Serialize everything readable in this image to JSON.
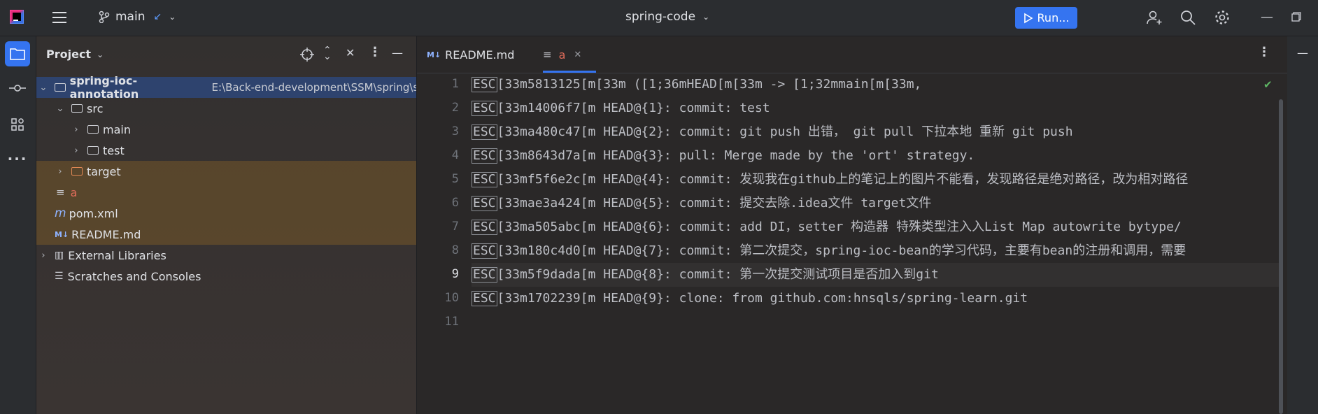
{
  "titlebar": {
    "branch": "main",
    "project": "spring-code",
    "run_label": "Run..."
  },
  "project_panel": {
    "title": "Project",
    "tree": [
      {
        "label": "spring-ioc-annotation",
        "path": "E:\\Back-end-development\\SSM\\spring\\s",
        "kind": "module"
      },
      {
        "label": "src",
        "kind": "folder"
      },
      {
        "label": "main",
        "kind": "folder"
      },
      {
        "label": "test",
        "kind": "folder"
      },
      {
        "label": "target",
        "kind": "folder"
      },
      {
        "label": "a",
        "kind": "file"
      },
      {
        "label": "pom.xml",
        "kind": "file"
      },
      {
        "label": "README.md",
        "kind": "file"
      },
      {
        "label": "External Libraries",
        "kind": "lib"
      },
      {
        "label": "Scratches and Consoles",
        "kind": "scratch"
      }
    ]
  },
  "editor": {
    "tabs": [
      {
        "label": "README.md"
      },
      {
        "label": "a"
      }
    ],
    "line_numbers": [
      "1",
      "2",
      "3",
      "4",
      "5",
      "6",
      "7",
      "8",
      "9",
      "10",
      "11"
    ],
    "lines": [
      "[33m5813125[m[33m ([1;36mHEAD[m[33m -> [1;32mmain[m[33m,",
      "[33m14006f7[m HEAD@{1}: commit: test",
      "[33ma480c47[m HEAD@{2}: commit: git push 出错， git pull 下拉本地 重新 git push",
      "[33m8643d7a[m HEAD@{3}: pull: Merge made by the 'ort' strategy.",
      "[33mf5f6e2c[m HEAD@{4}: commit: 发现我在github上的笔记上的图片不能看，发现路径是绝对路径，改为相对路径",
      "[33mae3a424[m HEAD@{5}: commit: 提交去除.idea文件 target文件",
      "[33ma505abc[m HEAD@{6}: commit: add DI，setter 构造器 特殊类型注入入List Map autowrite bytype/",
      "[33m180c4d0[m HEAD@{7}: commit: 第二次提交，spring-ioc-bean的学习代码，主要有bean的注册和调用，需要",
      "[33m5f9dada[m HEAD@{8}: commit: 第一次提交测试项目是否加入到git",
      "[33m1702239[m HEAD@{9}: clone: from github.com:hnsqls/spring-learn.git",
      ""
    ]
  }
}
